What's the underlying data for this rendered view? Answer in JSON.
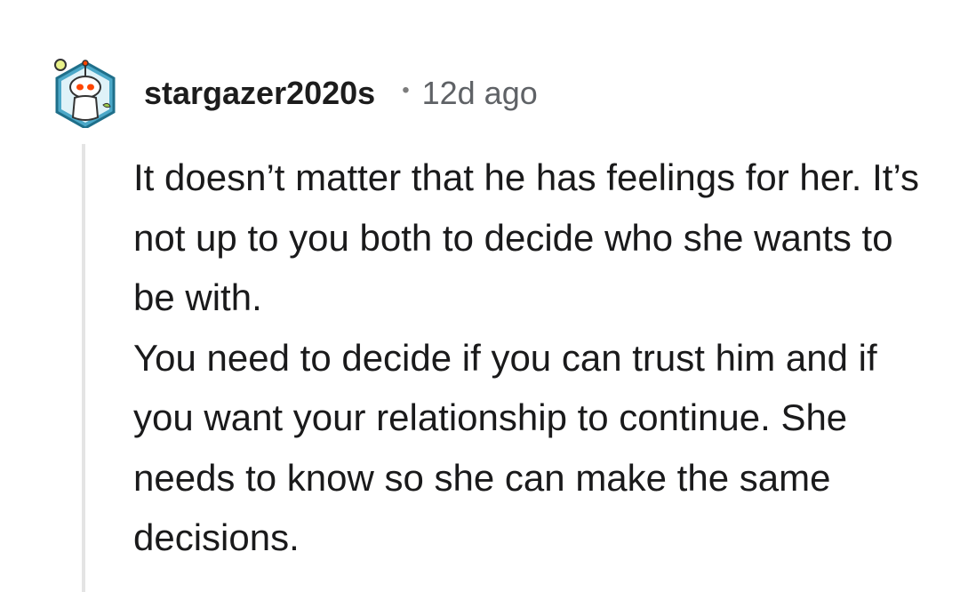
{
  "comment": {
    "author": "stargazer2020s",
    "separator": "•",
    "timestamp": "12d ago",
    "avatar": "snoo-avatar-icon",
    "paragraphs": [
      "It doesn’t matter that he has feelings for her. It’s not up to you both to decide who she wants to be with.",
      "You need to decide if you can trust him and if you want your relationship to continue. She needs to know so she can make the same decisions."
    ]
  },
  "colors": {
    "text": "#1a1a1b",
    "meta": "#5f6266",
    "thread_line": "#e4e4e4",
    "avatar_ring": "#1f8fb8"
  }
}
